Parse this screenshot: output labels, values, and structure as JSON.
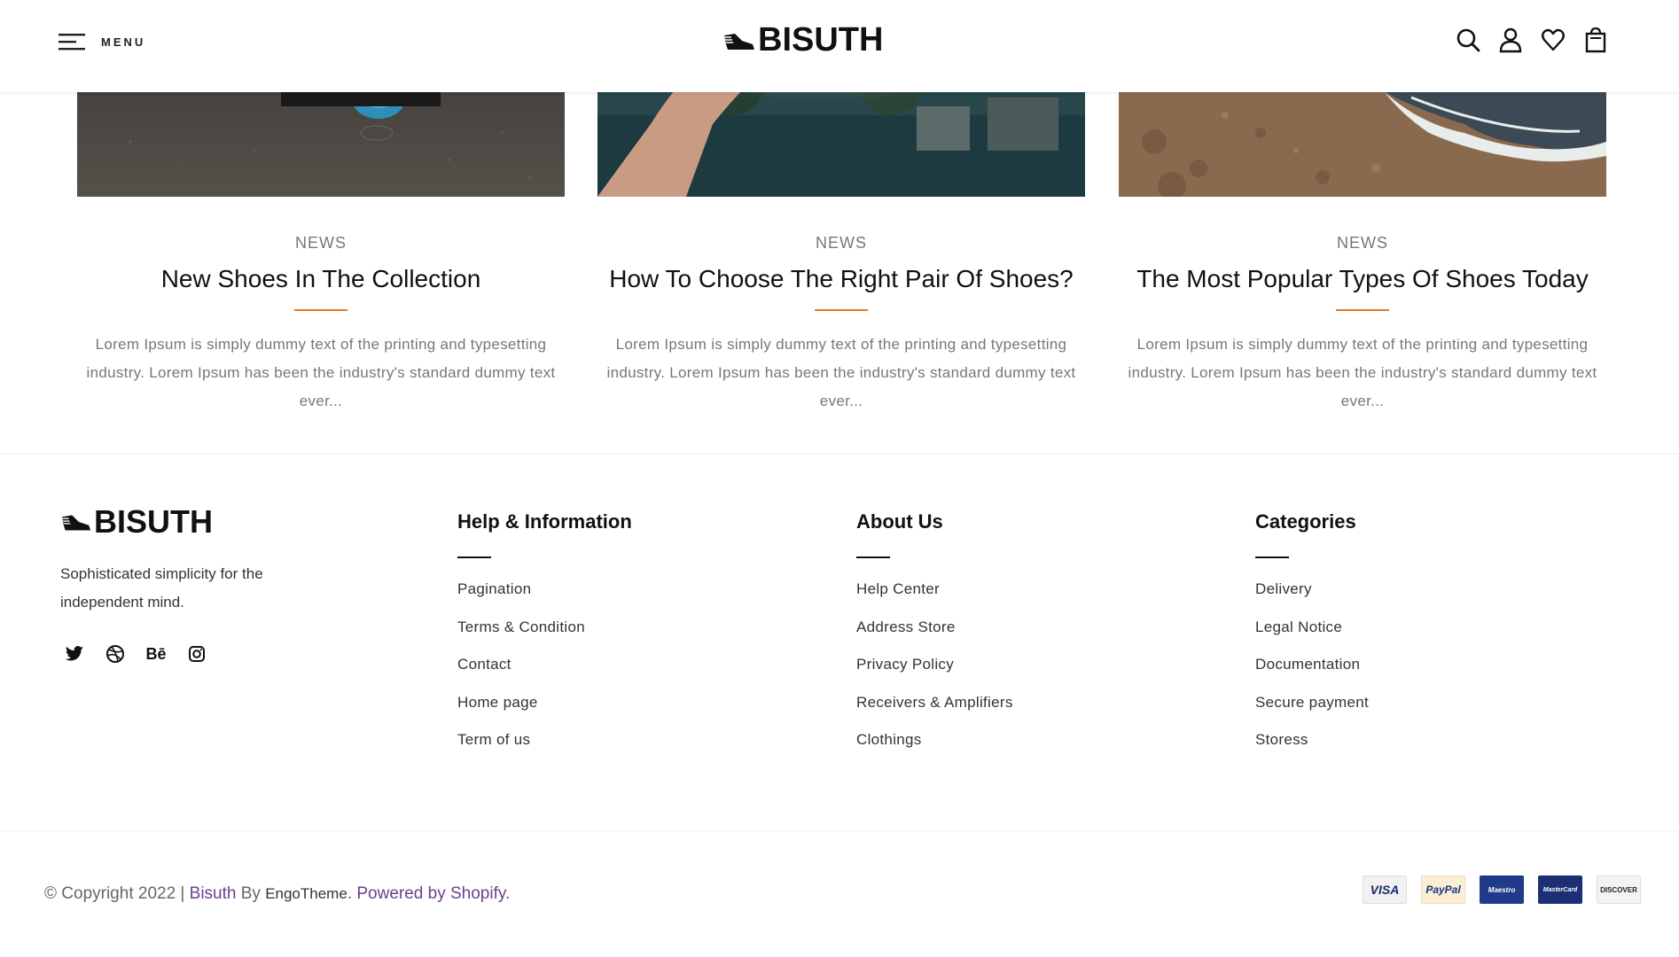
{
  "header": {
    "menu_label": "MENU",
    "logo_text": "BISUTH",
    "icons": [
      "search-icon",
      "user-icon",
      "heart-icon",
      "shopping-bag-icon"
    ]
  },
  "blog": {
    "posts": [
      {
        "category": "NEWS",
        "title": "New Shoes In The Collection",
        "excerpt": "Lorem Ipsum is simply dummy text of the printing and typesetting industry. Lorem Ipsum has been the industry's standard dummy text ever..."
      },
      {
        "category": "NEWS",
        "title": "How To Choose The Right Pair Of Shoes?",
        "excerpt": "Lorem Ipsum is simply dummy text of the printing and typesetting industry. Lorem Ipsum has been the industry's standard dummy text ever..."
      },
      {
        "category": "NEWS",
        "title": "The Most Popular Types Of Shoes Today",
        "excerpt": "Lorem Ipsum is simply dummy text of the printing and typesetting industry. Lorem Ipsum has been the industry's standard dummy text ever..."
      }
    ]
  },
  "footer": {
    "logo_text": "BISUTH",
    "tagline": "Sophisticated simplicity for the independent mind.",
    "socials": [
      "twitter-icon",
      "dribbble-icon",
      "behance-icon",
      "instagram-icon"
    ],
    "behance_glyph": "Bē",
    "columns": [
      {
        "title": "Help & Information",
        "links": [
          "Pagination",
          "Terms & Condition",
          "Contact",
          "Home page",
          "Term of us"
        ]
      },
      {
        "title": "About Us",
        "links": [
          "Help Center",
          "Address Store",
          "Privacy Policy",
          "Receivers & Amplifiers",
          "Clothings"
        ]
      },
      {
        "title": "Categories",
        "links": [
          "Delivery",
          "Legal Notice",
          "Documentation",
          "Secure payment",
          "Storess"
        ]
      }
    ],
    "copyright": {
      "prefix": "© Copyright 2022 | ",
      "brand": "Bisuth",
      "by": " By ",
      "author": "EngoTheme",
      "dot": ". ",
      "powered": "Powered by Shopify."
    },
    "payments": [
      "VISA",
      "PayPal",
      "Maestro",
      "MasterCard",
      "DISCOVER"
    ]
  },
  "colors": {
    "accent": "#e37b2c",
    "link": "#6b3f8f",
    "text_muted": "#777777"
  }
}
